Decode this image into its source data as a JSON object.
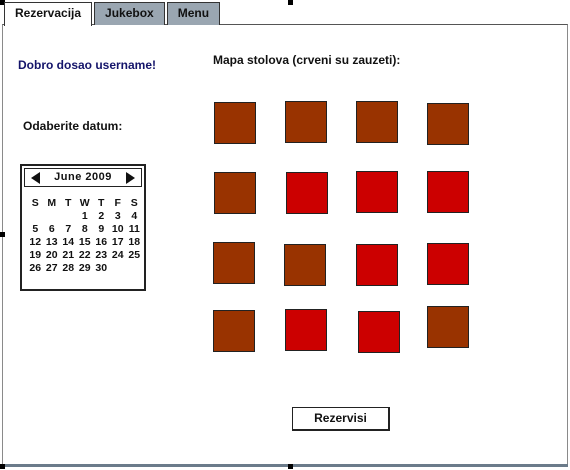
{
  "tabs": [
    "Rezervacija",
    "Jukebox",
    "Menu"
  ],
  "welcome": "Dobro dosao username!",
  "date_label": "Odaberite datum:",
  "map_title": "Mapa stolova (crveni su zauzeti):",
  "calendar": {
    "month": "June 2009",
    "weekdays": [
      "S",
      "M",
      "T",
      "W",
      "T",
      "F",
      "S"
    ],
    "days": [
      [
        "",
        "",
        "",
        "1",
        "2",
        "3",
        "4"
      ],
      [
        "5",
        "6",
        "7",
        "8",
        "9",
        "10",
        "11"
      ],
      [
        "12",
        "13",
        "14",
        "15",
        "16",
        "17",
        "18"
      ],
      [
        "19",
        "20",
        "21",
        "22",
        "23",
        "24",
        "25"
      ],
      [
        "26",
        "27",
        "28",
        "29",
        "30",
        "",
        ""
      ]
    ]
  },
  "tables": [
    [
      "free",
      "free",
      "free",
      "free"
    ],
    [
      "free",
      "busy",
      "busy",
      "busy"
    ],
    [
      "free",
      "free",
      "busy",
      "busy"
    ],
    [
      "free",
      "busy",
      "busy",
      "free"
    ]
  ],
  "colors": {
    "free": "#993300",
    "busy": "#cc0000",
    "inactive_tab": "#9aa6b1"
  },
  "reserve_button": "Rezervisi"
}
